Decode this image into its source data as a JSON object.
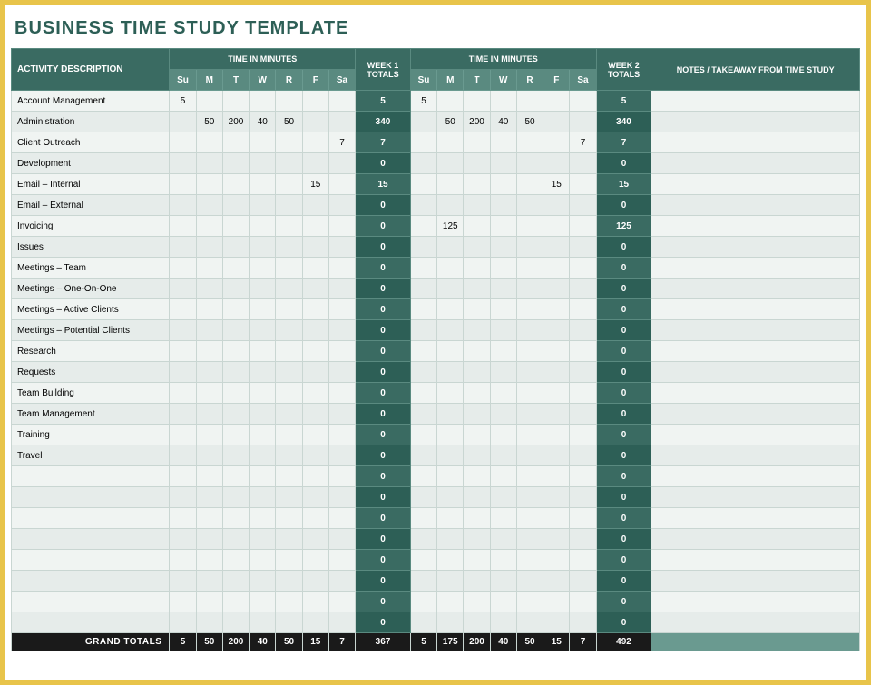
{
  "title": "BUSINESS TIME STUDY TEMPLATE",
  "headers": {
    "activity": "ACTIVITY DESCRIPTION",
    "time_in_minutes": "TIME IN MINUTES",
    "week1_totals": "WEEK 1 TOTALS",
    "week2_totals": "WEEK 2 TOTALS",
    "notes": "NOTES / TAKEAWAY FROM TIME STUDY",
    "grand_totals": "GRAND TOTALS"
  },
  "days": [
    "Su",
    "M",
    "T",
    "W",
    "R",
    "F",
    "Sa"
  ],
  "rows": [
    {
      "activity": "Account Management",
      "w1": [
        "5",
        "",
        "",
        "",
        "",
        "",
        ""
      ],
      "t1": "5",
      "w2": [
        "5",
        "",
        "",
        "",
        "",
        "",
        ""
      ],
      "t2": "5",
      "notes": ""
    },
    {
      "activity": "Administration",
      "w1": [
        "",
        "50",
        "200",
        "40",
        "50",
        "",
        ""
      ],
      "t1": "340",
      "w2": [
        "",
        "50",
        "200",
        "40",
        "50",
        "",
        ""
      ],
      "t2": "340",
      "notes": ""
    },
    {
      "activity": "Client Outreach",
      "w1": [
        "",
        "",
        "",
        "",
        "",
        "",
        "7"
      ],
      "t1": "7",
      "w2": [
        "",
        "",
        "",
        "",
        "",
        "",
        "7"
      ],
      "t2": "7",
      "notes": ""
    },
    {
      "activity": "Development",
      "w1": [
        "",
        "",
        "",
        "",
        "",
        "",
        ""
      ],
      "t1": "0",
      "w2": [
        "",
        "",
        "",
        "",
        "",
        "",
        ""
      ],
      "t2": "0",
      "notes": ""
    },
    {
      "activity": "Email – Internal",
      "w1": [
        "",
        "",
        "",
        "",
        "",
        "15",
        ""
      ],
      "t1": "15",
      "w2": [
        "",
        "",
        "",
        "",
        "",
        "15",
        ""
      ],
      "t2": "15",
      "notes": ""
    },
    {
      "activity": "Email – External",
      "w1": [
        "",
        "",
        "",
        "",
        "",
        "",
        ""
      ],
      "t1": "0",
      "w2": [
        "",
        "",
        "",
        "",
        "",
        "",
        ""
      ],
      "t2": "0",
      "notes": ""
    },
    {
      "activity": "Invoicing",
      "w1": [
        "",
        "",
        "",
        "",
        "",
        "",
        ""
      ],
      "t1": "0",
      "w2": [
        "",
        "125",
        "",
        "",
        "",
        "",
        ""
      ],
      "t2": "125",
      "notes": ""
    },
    {
      "activity": "Issues",
      "w1": [
        "",
        "",
        "",
        "",
        "",
        "",
        ""
      ],
      "t1": "0",
      "w2": [
        "",
        "",
        "",
        "",
        "",
        "",
        ""
      ],
      "t2": "0",
      "notes": ""
    },
    {
      "activity": "Meetings – Team",
      "w1": [
        "",
        "",
        "",
        "",
        "",
        "",
        ""
      ],
      "t1": "0",
      "w2": [
        "",
        "",
        "",
        "",
        "",
        "",
        ""
      ],
      "t2": "0",
      "notes": ""
    },
    {
      "activity": "Meetings – One-On-One",
      "w1": [
        "",
        "",
        "",
        "",
        "",
        "",
        ""
      ],
      "t1": "0",
      "w2": [
        "",
        "",
        "",
        "",
        "",
        "",
        ""
      ],
      "t2": "0",
      "notes": ""
    },
    {
      "activity": "Meetings – Active Clients",
      "w1": [
        "",
        "",
        "",
        "",
        "",
        "",
        ""
      ],
      "t1": "0",
      "w2": [
        "",
        "",
        "",
        "",
        "",
        "",
        ""
      ],
      "t2": "0",
      "notes": ""
    },
    {
      "activity": "Meetings – Potential Clients",
      "w1": [
        "",
        "",
        "",
        "",
        "",
        "",
        ""
      ],
      "t1": "0",
      "w2": [
        "",
        "",
        "",
        "",
        "",
        "",
        ""
      ],
      "t2": "0",
      "notes": ""
    },
    {
      "activity": "Research",
      "w1": [
        "",
        "",
        "",
        "",
        "",
        "",
        ""
      ],
      "t1": "0",
      "w2": [
        "",
        "",
        "",
        "",
        "",
        "",
        ""
      ],
      "t2": "0",
      "notes": ""
    },
    {
      "activity": "Requests",
      "w1": [
        "",
        "",
        "",
        "",
        "",
        "",
        ""
      ],
      "t1": "0",
      "w2": [
        "",
        "",
        "",
        "",
        "",
        "",
        ""
      ],
      "t2": "0",
      "notes": ""
    },
    {
      "activity": "Team Building",
      "w1": [
        "",
        "",
        "",
        "",
        "",
        "",
        ""
      ],
      "t1": "0",
      "w2": [
        "",
        "",
        "",
        "",
        "",
        "",
        ""
      ],
      "t2": "0",
      "notes": ""
    },
    {
      "activity": "Team Management",
      "w1": [
        "",
        "",
        "",
        "",
        "",
        "",
        ""
      ],
      "t1": "0",
      "w2": [
        "",
        "",
        "",
        "",
        "",
        "",
        ""
      ],
      "t2": "0",
      "notes": ""
    },
    {
      "activity": "Training",
      "w1": [
        "",
        "",
        "",
        "",
        "",
        "",
        ""
      ],
      "t1": "0",
      "w2": [
        "",
        "",
        "",
        "",
        "",
        "",
        ""
      ],
      "t2": "0",
      "notes": ""
    },
    {
      "activity": "Travel",
      "w1": [
        "",
        "",
        "",
        "",
        "",
        "",
        ""
      ],
      "t1": "0",
      "w2": [
        "",
        "",
        "",
        "",
        "",
        "",
        ""
      ],
      "t2": "0",
      "notes": ""
    },
    {
      "activity": "",
      "w1": [
        "",
        "",
        "",
        "",
        "",
        "",
        ""
      ],
      "t1": "0",
      "w2": [
        "",
        "",
        "",
        "",
        "",
        "",
        ""
      ],
      "t2": "0",
      "notes": ""
    },
    {
      "activity": "",
      "w1": [
        "",
        "",
        "",
        "",
        "",
        "",
        ""
      ],
      "t1": "0",
      "w2": [
        "",
        "",
        "",
        "",
        "",
        "",
        ""
      ],
      "t2": "0",
      "notes": ""
    },
    {
      "activity": "",
      "w1": [
        "",
        "",
        "",
        "",
        "",
        "",
        ""
      ],
      "t1": "0",
      "w2": [
        "",
        "",
        "",
        "",
        "",
        "",
        ""
      ],
      "t2": "0",
      "notes": ""
    },
    {
      "activity": "",
      "w1": [
        "",
        "",
        "",
        "",
        "",
        "",
        ""
      ],
      "t1": "0",
      "w2": [
        "",
        "",
        "",
        "",
        "",
        "",
        ""
      ],
      "t2": "0",
      "notes": ""
    },
    {
      "activity": "",
      "w1": [
        "",
        "",
        "",
        "",
        "",
        "",
        ""
      ],
      "t1": "0",
      "w2": [
        "",
        "",
        "",
        "",
        "",
        "",
        ""
      ],
      "t2": "0",
      "notes": ""
    },
    {
      "activity": "",
      "w1": [
        "",
        "",
        "",
        "",
        "",
        "",
        ""
      ],
      "t1": "0",
      "w2": [
        "",
        "",
        "",
        "",
        "",
        "",
        ""
      ],
      "t2": "0",
      "notes": ""
    },
    {
      "activity": "",
      "w1": [
        "",
        "",
        "",
        "",
        "",
        "",
        ""
      ],
      "t1": "0",
      "w2": [
        "",
        "",
        "",
        "",
        "",
        "",
        ""
      ],
      "t2": "0",
      "notes": ""
    },
    {
      "activity": "",
      "w1": [
        "",
        "",
        "",
        "",
        "",
        "",
        ""
      ],
      "t1": "0",
      "w2": [
        "",
        "",
        "",
        "",
        "",
        "",
        ""
      ],
      "t2": "0",
      "notes": ""
    }
  ],
  "grand": {
    "w1": [
      "5",
      "50",
      "200",
      "40",
      "50",
      "15",
      "7"
    ],
    "t1": "367",
    "w2": [
      "5",
      "175",
      "200",
      "40",
      "50",
      "15",
      "7"
    ],
    "t2": "492"
  }
}
